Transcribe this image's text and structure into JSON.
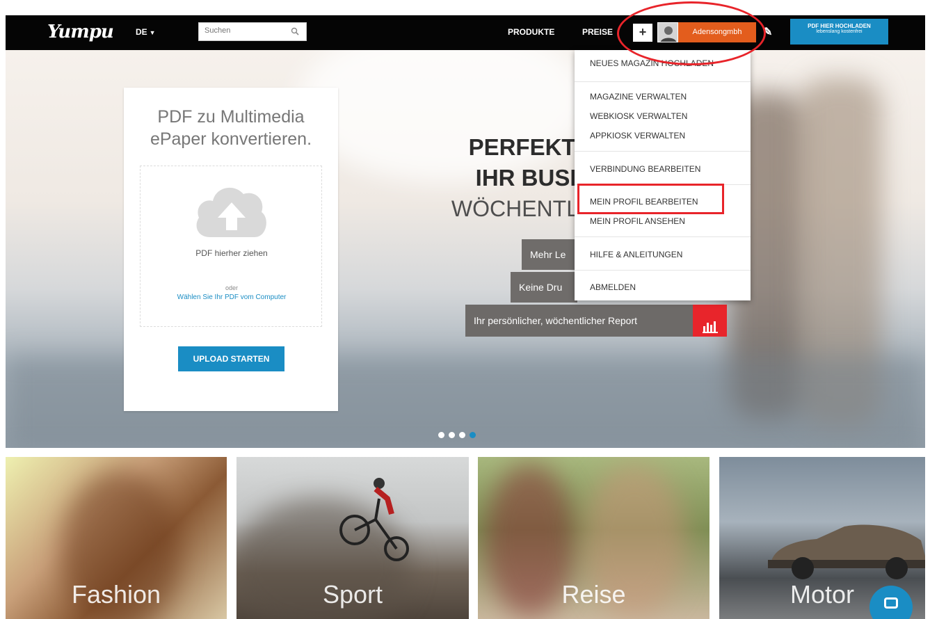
{
  "nav": {
    "logo": "Yumpu",
    "language": "DE",
    "search_placeholder": "Suchen",
    "links": [
      "PRODUKTE",
      "PREISE"
    ],
    "plus": "+",
    "user_name": "Adensongmbh",
    "pen": "✎",
    "upload_line1": "PDF HIER HOCHLADEN",
    "upload_line2": "lebenslang kostenfrei"
  },
  "upload_card": {
    "title_line1": "PDF zu Multimedia",
    "title_line2": "ePaper konvertieren.",
    "drop_text": "PDF hierher ziehen",
    "or_text": "oder",
    "choose_link": "Wählen Sie Ihr PDF vom Computer",
    "button": "UPLOAD STARTEN"
  },
  "hero": {
    "headline_line1": "PERFEKTIO",
    "headline_line2": "IHR BUSIN",
    "headline_line3": "WÖCHENTLICH",
    "feature1": "Mehr Le",
    "feature2": "Keine Dru",
    "report": "Ihr persönlicher, wöchentlicher Report",
    "slide_count": 4,
    "active_slide": 4
  },
  "menu": {
    "items": [
      "NEUES MAGAZIN HOCHLADEN",
      "MAGAZINE VERWALTEN",
      "WEBKIOSK VERWALTEN",
      "APPKIOSK VERWALTEN",
      "VERBINDUNG BEARBEITEN",
      "MEIN PROFIL BEARBEITEN",
      "MEIN PROFIL ANSEHEN",
      "HILFE & ANLEITUNGEN",
      "ABMELDEN"
    ]
  },
  "categories": [
    "Fashion",
    "Sport",
    "Reise",
    "Motor"
  ],
  "colors": {
    "brand_blue": "#1a8dc4",
    "user_orange": "#e35d1d",
    "annotation_red": "#e8242a",
    "report_red": "#e8252b",
    "nav_black": "#050505"
  }
}
